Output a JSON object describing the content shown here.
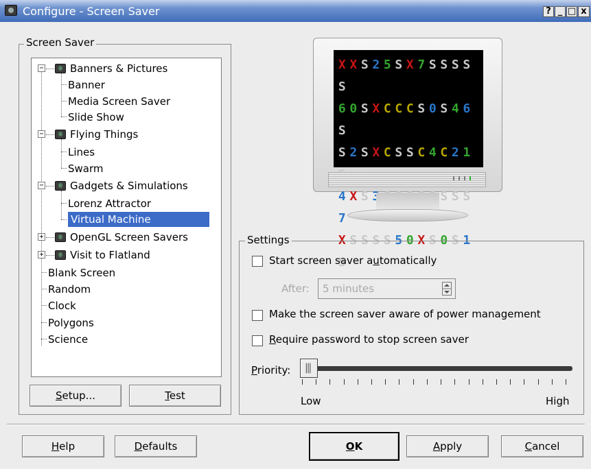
{
  "window": {
    "title": "Configure - Screen Saver",
    "buttons": [
      "?",
      "_",
      "□",
      "x"
    ]
  },
  "screensaver_group": {
    "title": "Screen Saver",
    "tree": [
      {
        "label": "Banners & Pictures",
        "type": "category",
        "expanded": true
      },
      {
        "label": "Banner",
        "type": "item"
      },
      {
        "label": "Media Screen Saver",
        "type": "item"
      },
      {
        "label": "Slide Show",
        "type": "item"
      },
      {
        "label": "Flying Things",
        "type": "category",
        "expanded": true
      },
      {
        "label": "Lines",
        "type": "item"
      },
      {
        "label": "Swarm",
        "type": "item"
      },
      {
        "label": "Gadgets & Simulations",
        "type": "category",
        "expanded": true
      },
      {
        "label": "Lorenz Attractor",
        "type": "item"
      },
      {
        "label": "Virtual Machine",
        "type": "item",
        "selected": true
      },
      {
        "label": "OpenGL Screen Savers",
        "type": "category",
        "expanded": false
      },
      {
        "label": "Visit to Flatland",
        "type": "category",
        "expanded": false
      },
      {
        "label": "Blank Screen",
        "type": "top"
      },
      {
        "label": "Random",
        "type": "top"
      },
      {
        "label": "Clock",
        "type": "top"
      },
      {
        "label": "Polygons",
        "type": "top"
      },
      {
        "label": "Science",
        "type": "top"
      }
    ],
    "setup_button": {
      "pre": "",
      "ul": "S",
      "post": "etup..."
    },
    "test_button": {
      "pre": "",
      "ul": "T",
      "post": "est"
    }
  },
  "preview": {
    "rows": [
      "XXS25SX7SSSSS",
      "60SXCCCS0S46S",
      "S2SXCSSC4C21S",
      "4XS3SSSSSSSS7",
      "XSSSS50XS0S1S"
    ]
  },
  "settings": {
    "title": "Settings",
    "auto_start": {
      "pre": "Start screen saver a",
      "ul": "u",
      "post": "tomatically",
      "checked": false
    },
    "after_label": "After:",
    "after_value": "5 minutes",
    "power_mgmt": {
      "label": "Make the screen saver aware of power management",
      "checked": false
    },
    "require_password": {
      "pre": "",
      "ul": "R",
      "post": "equire password to stop screen saver",
      "checked": false
    },
    "priority": {
      "pre": "",
      "ul": "P",
      "post": "riority:",
      "low": "Low",
      "high": "High",
      "value_fraction": 0.0
    }
  },
  "footer": {
    "help": {
      "pre": "",
      "ul": "H",
      "post": "elp"
    },
    "defaults": {
      "pre": "",
      "ul": "D",
      "post": "efaults"
    },
    "ok": {
      "pre": "",
      "ul": "O",
      "post": "K"
    },
    "apply": {
      "pre": "",
      "ul": "A",
      "post": "pply"
    },
    "cancel": {
      "pre": "",
      "ul": "C",
      "post": "ancel"
    }
  },
  "colors": {
    "selection": "#3c6bc8",
    "titlebar": "#4a74bd",
    "vm_red": "#c81414",
    "vm_green": "#33a52e",
    "vm_blue": "#2a76c8",
    "vm_yellow": "#b8a800",
    "vm_grey": "#c8c8c8"
  }
}
